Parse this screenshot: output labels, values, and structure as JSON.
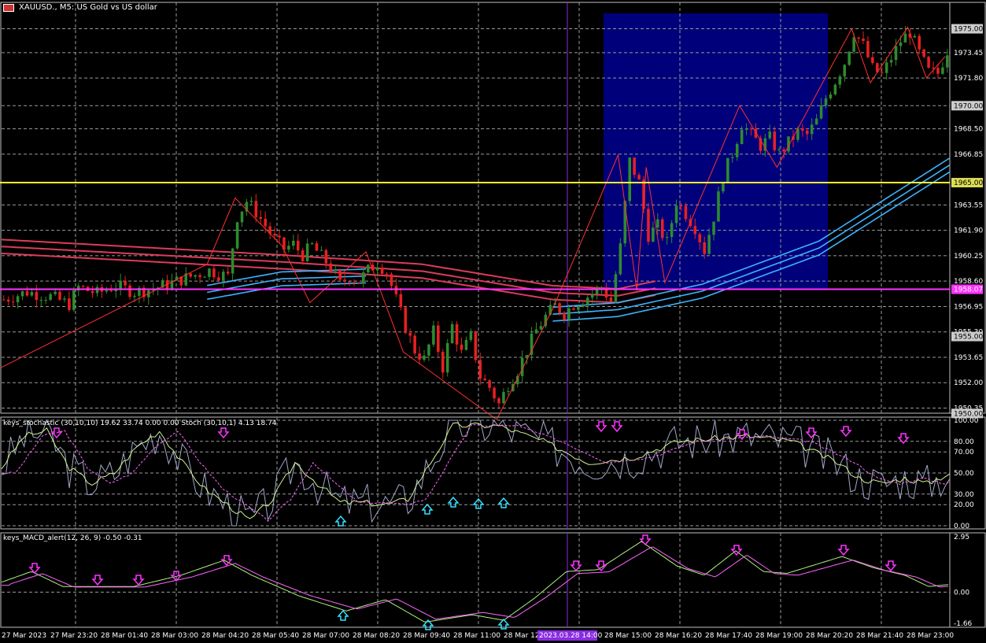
{
  "header": {
    "symbol_label": "XAUUSD., M5:",
    "description": "US Gold vs US dollar"
  },
  "main": {
    "price_labels": [
      "1975.00",
      "1973.45",
      "1971.80",
      "1970.00",
      "1968.50",
      "1966.85",
      "1965.00",
      "1963.55",
      "1961.90",
      "1960.25",
      "1958.60",
      "1956.95",
      "1955.30",
      "1953.65",
      "1952.00",
      "1950.35"
    ],
    "price_min": 1949.3,
    "price_max": 1976.0,
    "badge_labels": {
      "top": "1975.00",
      "r1970": "1970.00",
      "yellow": "1965.00",
      "magenta": "1958.07",
      "r1955": "1955.00",
      "r1950": "1950.00"
    },
    "colors": {
      "up": "#2e8b2e",
      "down": "#e82020",
      "zigzag": "#ff3030",
      "ma_red": "#dc3c5a",
      "ma_blue": "#3cb4ff",
      "rect": "#00007a",
      "yellow_line": "#ffff33",
      "magenta_line": "#ff33ff",
      "vline": "#8a2be2"
    },
    "levels": {
      "yellow": 1965.0,
      "magenta": 1958.07
    }
  },
  "stoch": {
    "title": "keys_stochastic (30,10,10) 19.62 33.74 0.00 0.00 Stoch (30,10,1) 4.13 18.74",
    "axis_labels": [
      "100.00",
      "80.00",
      "70.00",
      "50.00",
      "30.00",
      "20.00",
      "0.00"
    ]
  },
  "macd": {
    "title": "keys_MACD_alert(12, 26, 9) -0.50 -0.31",
    "axis_labels": [
      "2.95",
      "0.00",
      "-1.66"
    ]
  },
  "time_axis": {
    "labels": [
      "27 Mar 2023",
      "27 Mar 23:20",
      "28 Mar 01:40",
      "28 Mar 03:00",
      "28 Mar 04:20",
      "28 Mar 05:40",
      "28 Mar 07:00",
      "28 Mar 08:20",
      "28 Mar 09:40",
      "28 Mar 11:00",
      "28 Mar 12",
      "28 Mar 15:00",
      "28 Mar 16:20",
      "28 Mar 17:40",
      "28 Mar 19:00",
      "28 Mar 20:20",
      "28 Mar 21:40",
      "28 Mar 23:00"
    ],
    "highlight": "2023.03.28 14:00"
  },
  "chart_data": {
    "type": "candlestick",
    "title": "XAUUSD., M5: US Gold vs US dollar",
    "ylim": [
      1949.3,
      1976.0
    ],
    "close_path": [
      [
        0,
        1957.4
      ],
      [
        5,
        1957.9
      ],
      [
        10,
        1957.6
      ],
      [
        14,
        1957.1
      ],
      [
        16,
        1958.2
      ],
      [
        20,
        1957.8
      ],
      [
        24,
        1958.3
      ],
      [
        28,
        1957.9
      ],
      [
        32,
        1958.1
      ],
      [
        36,
        1958.5
      ],
      [
        40,
        1958.9
      ],
      [
        44,
        1959.3
      ],
      [
        48,
        1958.9
      ],
      [
        50,
        1962.8
      ],
      [
        52,
        1963.8
      ],
      [
        54,
        1963.1
      ],
      [
        56,
        1962.2
      ],
      [
        58,
        1961.3
      ],
      [
        60,
        1960.7
      ],
      [
        62,
        1961.0
      ],
      [
        64,
        1960.3
      ],
      [
        66,
        1960.9
      ],
      [
        68,
        1960.2
      ],
      [
        70,
        1959.5
      ],
      [
        72,
        1958.4
      ],
      [
        74,
        1958.9
      ],
      [
        76,
        1958.6
      ],
      [
        78,
        1959.3
      ],
      [
        80,
        1959.8
      ],
      [
        82,
        1959.2
      ],
      [
        84,
        1957.4
      ],
      [
        86,
        1955.6
      ],
      [
        88,
        1954.1
      ],
      [
        90,
        1953.5
      ],
      [
        92,
        1955.3
      ],
      [
        94,
        1953.0
      ],
      [
        96,
        1955.7
      ],
      [
        98,
        1953.9
      ],
      [
        100,
        1955.0
      ],
      [
        102,
        1952.4
      ],
      [
        104,
        1951.7
      ],
      [
        106,
        1950.6
      ],
      [
        108,
        1951.9
      ],
      [
        110,
        1952.8
      ],
      [
        112,
        1954.1
      ],
      [
        114,
        1955.4
      ],
      [
        116,
        1956.3
      ],
      [
        118,
        1957.0
      ],
      [
        120,
        1956.5
      ],
      [
        122,
        1957.1
      ],
      [
        124,
        1957.4
      ],
      [
        126,
        1957.8
      ],
      [
        128,
        1958.2
      ],
      [
        130,
        1957.3
      ],
      [
        132,
        1960.8
      ],
      [
        134,
        1966.4
      ],
      [
        136,
        1965.0
      ],
      [
        138,
        1961.6
      ],
      [
        140,
        1962.2
      ],
      [
        142,
        1961.1
      ],
      [
        144,
        1963.8
      ],
      [
        146,
        1963.0
      ],
      [
        148,
        1962.1
      ],
      [
        150,
        1960.6
      ],
      [
        152,
        1962.8
      ],
      [
        154,
        1965.4
      ],
      [
        156,
        1966.9
      ],
      [
        158,
        1968.8
      ],
      [
        160,
        1968.1
      ],
      [
        162,
        1967.4
      ],
      [
        164,
        1967.9
      ],
      [
        166,
        1966.9
      ],
      [
        168,
        1967.6
      ],
      [
        170,
        1968.3
      ],
      [
        172,
        1968.1
      ],
      [
        174,
        1969.0
      ],
      [
        176,
        1970.5
      ],
      [
        178,
        1971.6
      ],
      [
        180,
        1972.8
      ],
      [
        182,
        1974.8
      ],
      [
        184,
        1973.9
      ],
      [
        186,
        1972.4
      ],
      [
        188,
        1972.0
      ],
      [
        190,
        1973.1
      ],
      [
        192,
        1974.2
      ],
      [
        194,
        1974.8
      ],
      [
        196,
        1973.4
      ],
      [
        198,
        1972.2
      ],
      [
        200,
        1972.1
      ],
      [
        202,
        1973.6
      ]
    ],
    "zigzag": [
      [
        0,
        1953.0
      ],
      [
        44,
        1959.7
      ],
      [
        50,
        1964.0
      ],
      [
        60,
        1960.9
      ],
      [
        66,
        1957.2
      ],
      [
        78,
        1960.5
      ],
      [
        86,
        1954.0
      ],
      [
        106,
        1949.6
      ],
      [
        118,
        1956.8
      ],
      [
        132,
        1966.8
      ],
      [
        136,
        1958.0
      ],
      [
        138,
        1966.0
      ],
      [
        142,
        1958.5
      ],
      [
        158,
        1970.0
      ],
      [
        166,
        1966.0
      ],
      [
        182,
        1975.0
      ],
      [
        186,
        1971.5
      ],
      [
        194,
        1975.1
      ],
      [
        198,
        1971.8
      ],
      [
        202,
        1973.2
      ]
    ],
    "moving_averages": {
      "red": "three slow averages near 1958-1960 declining to ~1957 then rising",
      "blue": "three averages near 1958-1959 rising to ~1966.5 at end"
    },
    "stochastic_range": [
      0,
      100
    ],
    "macd_range": [
      -1.66,
      2.95
    ]
  }
}
